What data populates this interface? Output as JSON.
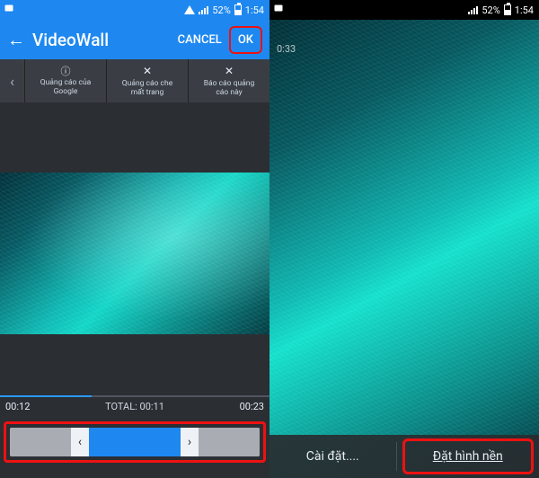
{
  "left": {
    "status": {
      "battery_pct": "52%",
      "time": "1:54"
    },
    "appbar": {
      "title": "VideoWall",
      "cancel": "CANCEL",
      "ok": "OK"
    },
    "ads": {
      "item1_line1": "Quảng cáo của",
      "item1_line2": "Google",
      "item2_line1": "Quảng cáo che",
      "item2_line2": "mất trang",
      "item3_line1": "Báo cáo quảng",
      "item3_line2": "cáo này"
    },
    "time": {
      "start": "00:12",
      "total_label": "TOTAL: 00:11",
      "end": "00:23"
    }
  },
  "right": {
    "status": {
      "battery_pct": "52%",
      "time": "1:54"
    },
    "overlay_ts": "0:33",
    "buttons": {
      "settings": "Cài đặt....",
      "set_wallpaper": "Đặt hình nền"
    }
  }
}
